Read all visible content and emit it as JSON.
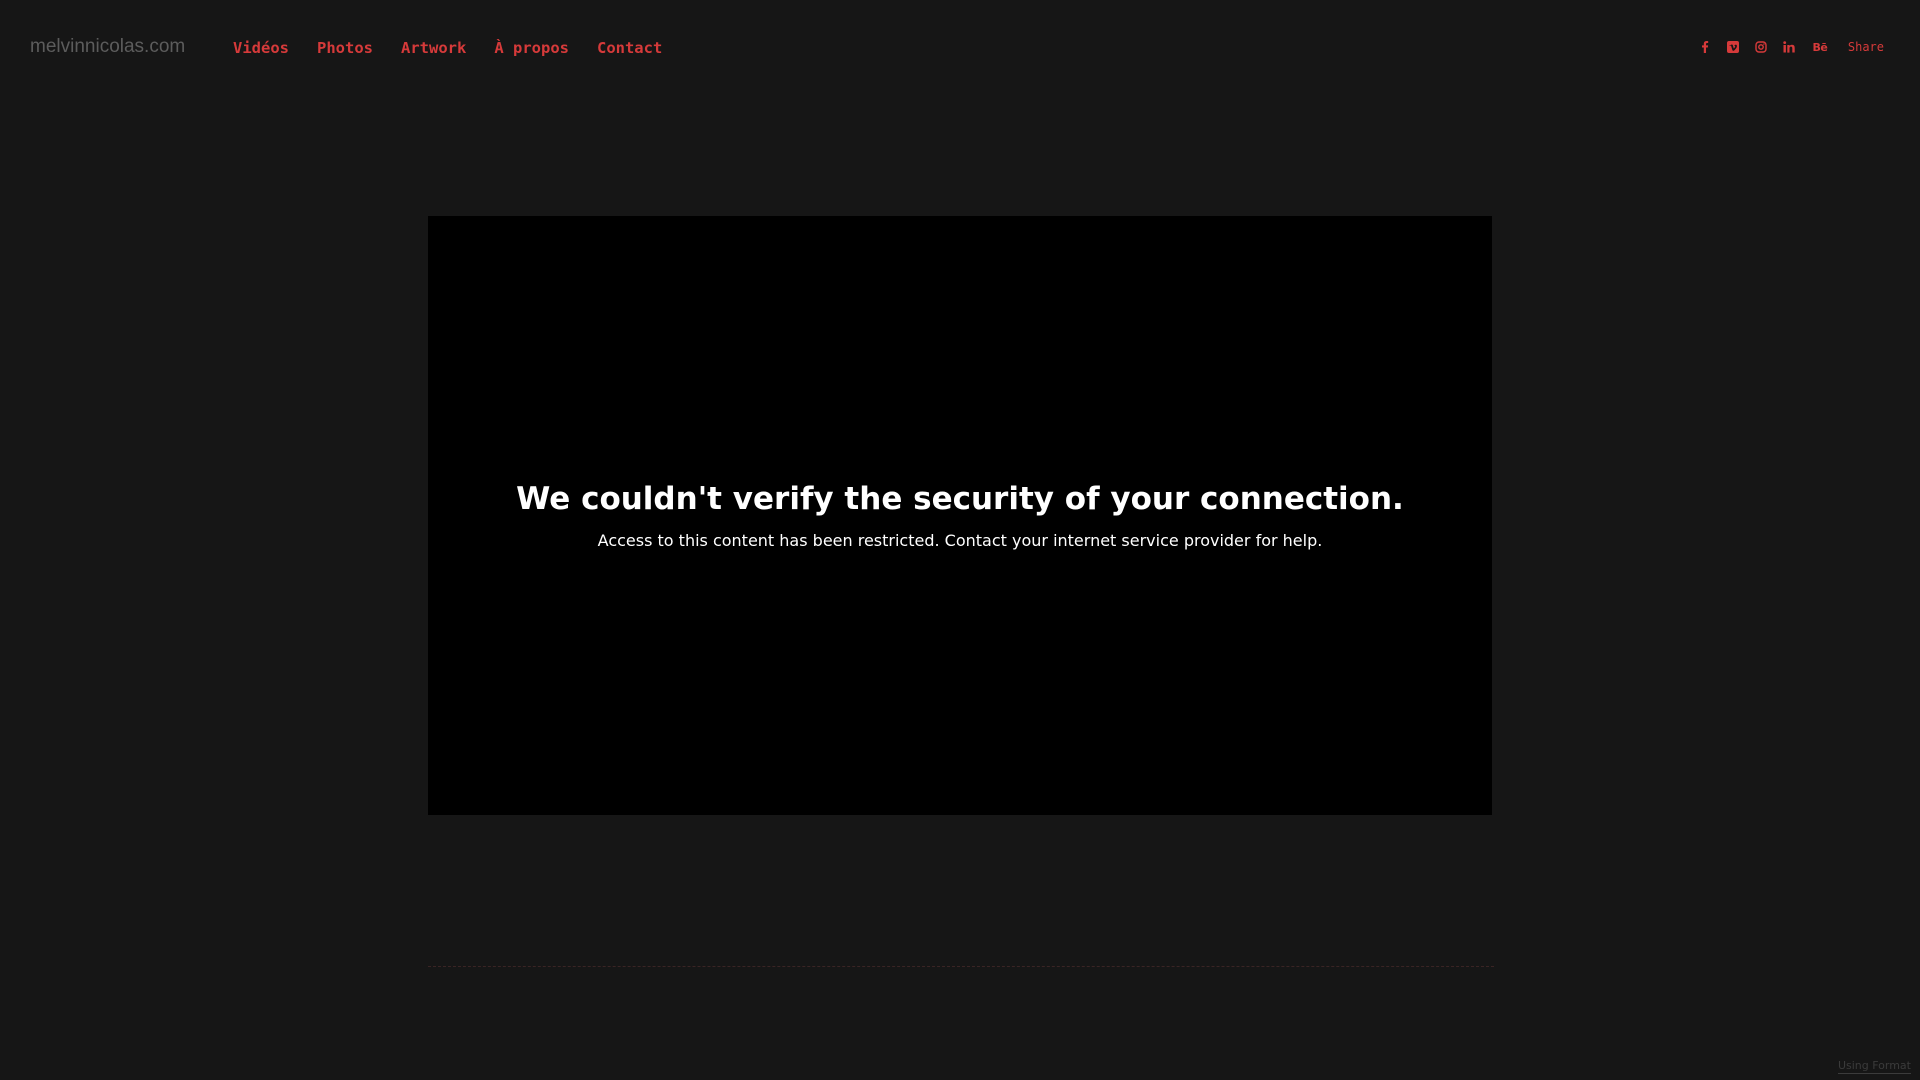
{
  "header": {
    "site_title": "melvinnicolas.com",
    "nav": [
      {
        "label": "Vidéos"
      },
      {
        "label": "Photos"
      },
      {
        "label": "Artwork"
      },
      {
        "label": "À propos"
      },
      {
        "label": "Contact"
      }
    ],
    "social_icons": [
      "facebook-icon",
      "vimeo-icon",
      "instagram-icon",
      "linkedin-icon",
      "behance-icon"
    ],
    "behance_glyph": "Bē",
    "share_label": "Share"
  },
  "video": {
    "error_title": "We couldn't verify the security of your connection.",
    "error_message": "Access to this content has been restricted. Contact your internet service provider for help."
  },
  "footer": {
    "credit": "Using Format"
  },
  "colors": {
    "background": "#161616",
    "accent": "#d63a3a",
    "video_background": "#000000",
    "site_title": "#5c5c5c"
  }
}
